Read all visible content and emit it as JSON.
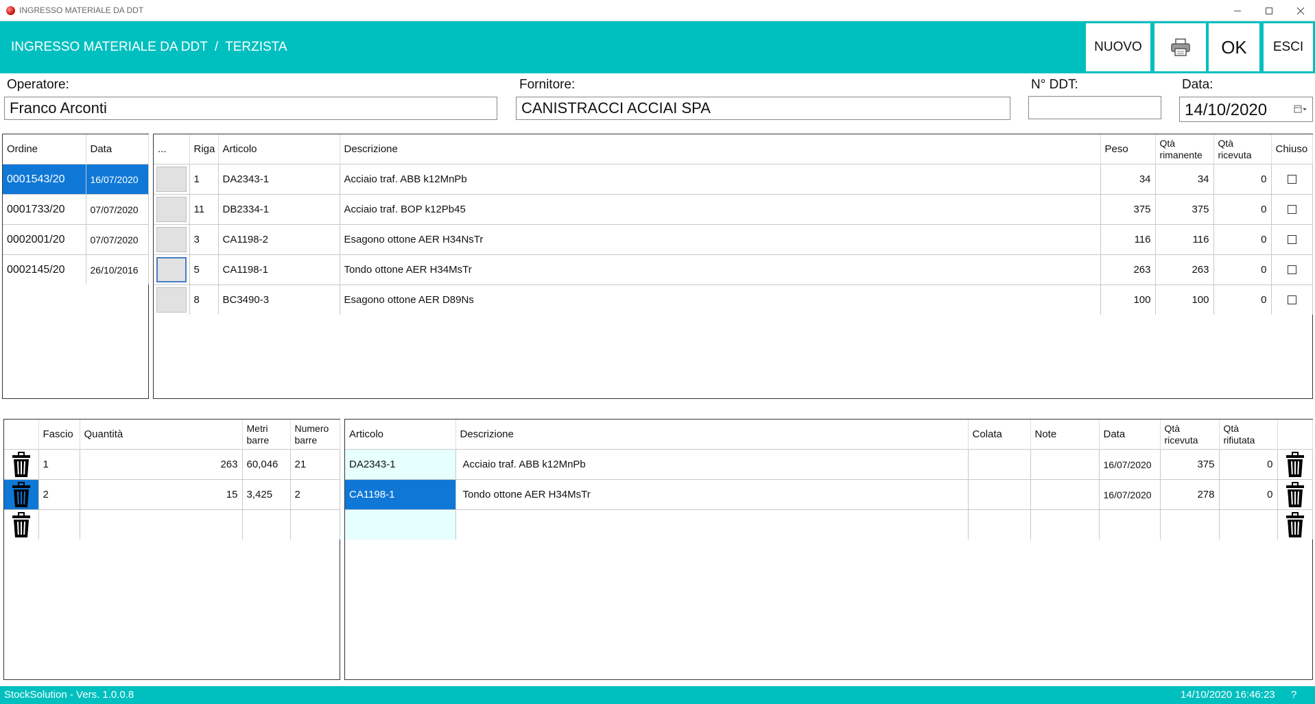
{
  "window": {
    "title": "INGRESSO MATERIALE DA DDT"
  },
  "header": {
    "breadcrumb": [
      "INGRESSO MATERIALE DA DDT",
      "/",
      "TERZISTA"
    ],
    "buttons": {
      "new": "NUOVO",
      "ok": "OK",
      "exit": "ESCI"
    },
    "accent_color": "#00bfbf"
  },
  "form": {
    "operator_label": "Operatore:",
    "operator_value": "Franco Arconti",
    "supplier_label": "Fornitore:",
    "supplier_value": "CANISTRACCI ACCIAI SPA",
    "ddt_label": "N° DDT:",
    "ddt_value": "",
    "date_label": "Data:",
    "date_value": "14/10/2020"
  },
  "orders": {
    "headers": [
      "Ordine",
      "Data"
    ],
    "rows": [
      {
        "ordine": "0001543/20",
        "data": "16/07/2020"
      },
      {
        "ordine": "0001733/20",
        "data": "07/07/2020"
      },
      {
        "ordine": "0002001/20",
        "data": "07/07/2020"
      },
      {
        "ordine": "0002145/20",
        "data": "26/10/2016"
      }
    ]
  },
  "lines": {
    "headers": [
      "...",
      "Riga",
      "Articolo",
      "Descrizione",
      "Peso",
      "Qtà rimanente",
      "Qtà ricevuta",
      "Chiuso"
    ],
    "rows": [
      {
        "riga": "1",
        "articolo": "DA2343-1",
        "descrizione": "Acciaio traf. ABB k12MnPb",
        "peso": "34",
        "rimanente": "34",
        "ricevuta": "0"
      },
      {
        "riga": "11",
        "articolo": "DB2334-1",
        "descrizione": "Acciaio traf. BOP k12Pb45",
        "peso": "375",
        "rimanente": "375",
        "ricevuta": "0"
      },
      {
        "riga": "3",
        "articolo": "CA1198-2",
        "descrizione": "Esagono ottone AER H34NsTr",
        "peso": "116",
        "rimanente": "116",
        "ricevuta": "0"
      },
      {
        "riga": "5",
        "articolo": "CA1198-1",
        "descrizione": "Tondo ottone AER H34MsTr",
        "peso": "263",
        "rimanente": "263",
        "ricevuta": "0"
      },
      {
        "riga": "8",
        "articolo": "BC3490-3",
        "descrizione": "Esagono ottone AER D89Ns",
        "peso": "100",
        "rimanente": "100",
        "ricevuta": "0"
      }
    ]
  },
  "bundles": {
    "headers": [
      "",
      "Fascio",
      "Quantità",
      "Metri barre",
      "Numero barre"
    ],
    "rows": [
      {
        "fascio": "1",
        "quantita": "263",
        "metri": "60,046",
        "numero": "21"
      },
      {
        "fascio": "2",
        "quantita": "15",
        "metri": "3,425",
        "numero": "2"
      },
      {
        "fascio": "",
        "quantita": "",
        "metri": "",
        "numero": ""
      }
    ]
  },
  "received": {
    "headers": [
      "Articolo",
      "Descrizione",
      "Colata",
      "Note",
      "Data",
      "Qtà ricevuta",
      "Qtà rifiutata",
      ""
    ],
    "rows": [
      {
        "articolo": "DA2343-1",
        "descrizione": "Acciaio traf. ABB k12MnPb",
        "colata": "",
        "note": "",
        "data": "16/07/2020",
        "ricevuta": "375",
        "rifiutata": "0"
      },
      {
        "articolo": "CA1198-1",
        "descrizione": "Tondo ottone AER H34MsTr",
        "colata": "",
        "note": "",
        "data": "16/07/2020",
        "ricevuta": "278",
        "rifiutata": "0"
      },
      {
        "articolo": "",
        "descrizione": "",
        "colata": "",
        "note": "",
        "data": "",
        "ricevuta": "",
        "rifiutata": ""
      }
    ]
  },
  "status": {
    "version": "StockSolution - Vers. 1.0.0.8",
    "datetime": "14/10/2020 16:46:23",
    "help": "?"
  },
  "icons": [
    "app-icon",
    "minimize-icon",
    "maximize-icon",
    "close-icon",
    "printer-icon",
    "calendar-icon",
    "trash-icon"
  ]
}
